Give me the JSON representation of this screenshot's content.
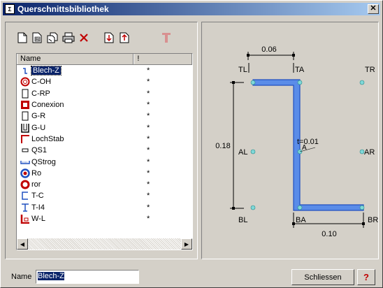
{
  "window": {
    "title": "Querschnittsbibliothek",
    "app_icon": "Σ"
  },
  "toolbar": {
    "icons": [
      "new-file-icon",
      "edit-file-icon",
      "copy-icon",
      "print-icon",
      "delete-icon",
      "import-icon",
      "export-icon",
      "section-icon"
    ]
  },
  "list": {
    "col_name": "Name",
    "col_flag": "!",
    "rows": [
      {
        "name": "Blech-Z",
        "flag": "*",
        "icon": "z-profile-icon",
        "selected": true
      },
      {
        "name": "C-OH",
        "flag": "*",
        "icon": "hollow-circle-icon"
      },
      {
        "name": "C-RP",
        "flag": "*",
        "icon": "rect-profile-icon"
      },
      {
        "name": "Conexion",
        "flag": "*",
        "icon": "red-box-icon"
      },
      {
        "name": "G-R",
        "flag": "*",
        "icon": "rect-profile-icon"
      },
      {
        "name": "G-U",
        "flag": "*",
        "icon": "u-profile-icon"
      },
      {
        "name": "LochStab",
        "flag": "*",
        "icon": "angle-profile-icon"
      },
      {
        "name": "QS1",
        "flag": "*",
        "icon": "small-rect-icon"
      },
      {
        "name": "QStrog",
        "flag": "*",
        "icon": "trough-icon"
      },
      {
        "name": "Ro",
        "flag": "*",
        "icon": "ring-blue-icon"
      },
      {
        "name": "ror",
        "flag": "*",
        "icon": "ring-red-icon"
      },
      {
        "name": "T-C",
        "flag": "*",
        "icon": "c-profile-icon"
      },
      {
        "name": "T-I4",
        "flag": "*",
        "icon": "t-profile-icon"
      },
      {
        "name": "W-L",
        "flag": "*",
        "icon": "l-profile-icon"
      }
    ]
  },
  "preview": {
    "dims": {
      "width_top": "0.06",
      "height": "0.18",
      "thickness": "t=0.01",
      "width_bottom": "0.10",
      "area": "A"
    },
    "points": {
      "TL": "TL",
      "TA": "TA",
      "TR": "TR",
      "AL": "AL",
      "AR": "AR",
      "BL": "BL",
      "BA": "BA",
      "BR": "BR"
    },
    "profile_color": "#5a8ce8"
  },
  "footer": {
    "name_label": "Name",
    "name_value": "Blech-Z",
    "close_label": "Schliessen",
    "help_label": "?"
  }
}
